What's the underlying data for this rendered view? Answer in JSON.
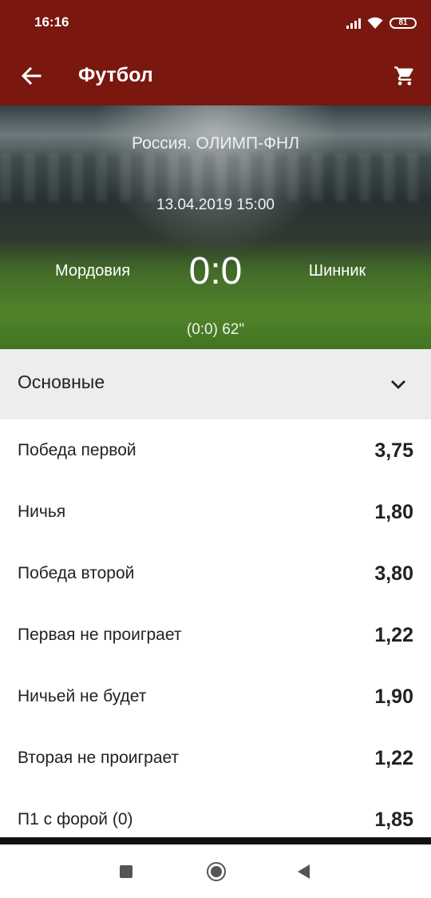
{
  "status_bar": {
    "time": "16:16",
    "battery": "81"
  },
  "app_bar": {
    "title": "Футбол",
    "back_icon": "arrow-left-icon",
    "cart_icon": "shopping-cart-icon"
  },
  "match": {
    "league": "Россия. ОЛИМП-ФНЛ",
    "datetime": "13.04.2019 15:00",
    "home_team": "Мордовия",
    "score": "0:0",
    "away_team": "Шинник",
    "sub_info": "(0:0) 62\""
  },
  "section": {
    "title": "Основные",
    "icon": "chevron-down-icon"
  },
  "bets": [
    {
      "name": "Победа первой",
      "odds": "3,75"
    },
    {
      "name": "Ничья",
      "odds": "1,80"
    },
    {
      "name": "Победа второй",
      "odds": "3,80"
    },
    {
      "name": "Первая не проиграет",
      "odds": "1,22"
    },
    {
      "name": "Ничьей не будет",
      "odds": "1,90"
    },
    {
      "name": "Вторая не проиграет",
      "odds": "1,22"
    },
    {
      "name": "П1 с форой (0)",
      "odds": "1,85"
    }
  ],
  "colors": {
    "brand": "#7a1810",
    "section_bg": "#ededed",
    "text": "#222222"
  }
}
